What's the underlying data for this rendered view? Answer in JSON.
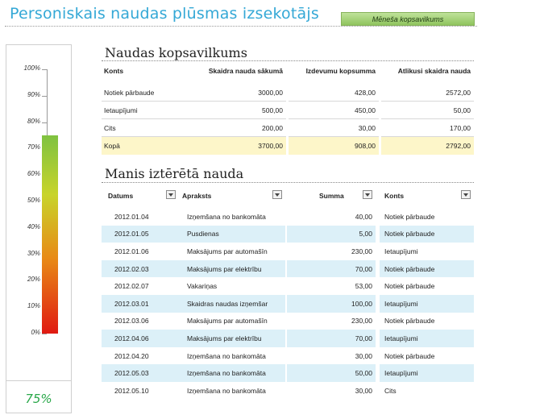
{
  "header": {
    "title": "Personiskais naudas plūsmas izsekotājs",
    "month_button": "Mēneša kopsavilkums"
  },
  "gauge": {
    "ticks": [
      "100%",
      "90%",
      "80%",
      "70%",
      "60%",
      "50%",
      "40%",
      "30%",
      "20%",
      "10%",
      "0%"
    ],
    "value_fraction": 0.75,
    "value_label": "75%",
    "colors": {
      "top": "#7fc241",
      "bottom": "#e01a12",
      "label": "#2aa84a"
    }
  },
  "summary": {
    "title": "Naudas kopsavilkums",
    "headers": [
      "Konts",
      "Skaidra nauda sākumā",
      "Izdevumu kopsumma",
      "Atlikusi skaidra nauda"
    ],
    "rows": [
      [
        "Notiek pārbaude",
        "3000,00",
        "428,00",
        "2572,00"
      ],
      [
        "Ietaupījumi",
        "500,00",
        "450,00",
        "50,00"
      ],
      [
        "Cits",
        "200,00",
        "30,00",
        "170,00"
      ]
    ],
    "total": [
      "Kopā",
      "3700,00",
      "908,00",
      "2792,00"
    ]
  },
  "spending": {
    "title": "Manis iztērētā nauda",
    "headers": [
      "Datums",
      "Apraksts",
      "Summa",
      "Konts"
    ],
    "rows": [
      [
        "2012.01.04",
        "Izņemšana no bankomāta",
        "40,00",
        "Notiek pārbaude"
      ],
      [
        "2012.01.05",
        "Pusdienas",
        "5,00",
        "Notiek pārbaude"
      ],
      [
        "2012.01.06",
        "Maksājums par automašīn",
        "230,00",
        "Ietaupījumi"
      ],
      [
        "2012.02.03",
        "Maksājums par elektrību",
        "70,00",
        "Notiek pārbaude"
      ],
      [
        "2012.02.07",
        "Vakariņas",
        "53,00",
        "Notiek pārbaude"
      ],
      [
        "2012.03.01",
        "Skaidras naudas izņemšar",
        "100,00",
        "Ietaupījumi"
      ],
      [
        "2012.03.06",
        "Maksājums par automašīn",
        "230,00",
        "Notiek pārbaude"
      ],
      [
        "2012.04.06",
        "Maksājums par elektrību",
        "70,00",
        "Ietaupījumi"
      ],
      [
        "2012.04.20",
        "Izņemšana no bankomāta",
        "30,00",
        "Notiek pārbaude"
      ],
      [
        "2012.05.03",
        "Izņemšana no bankomāta",
        "50,00",
        "Ietaupījumi"
      ],
      [
        "2012.05.10",
        "Izņemšana no bankomāta",
        "30,00",
        "Cits"
      ]
    ],
    "band_color": "#dcf0f8"
  }
}
